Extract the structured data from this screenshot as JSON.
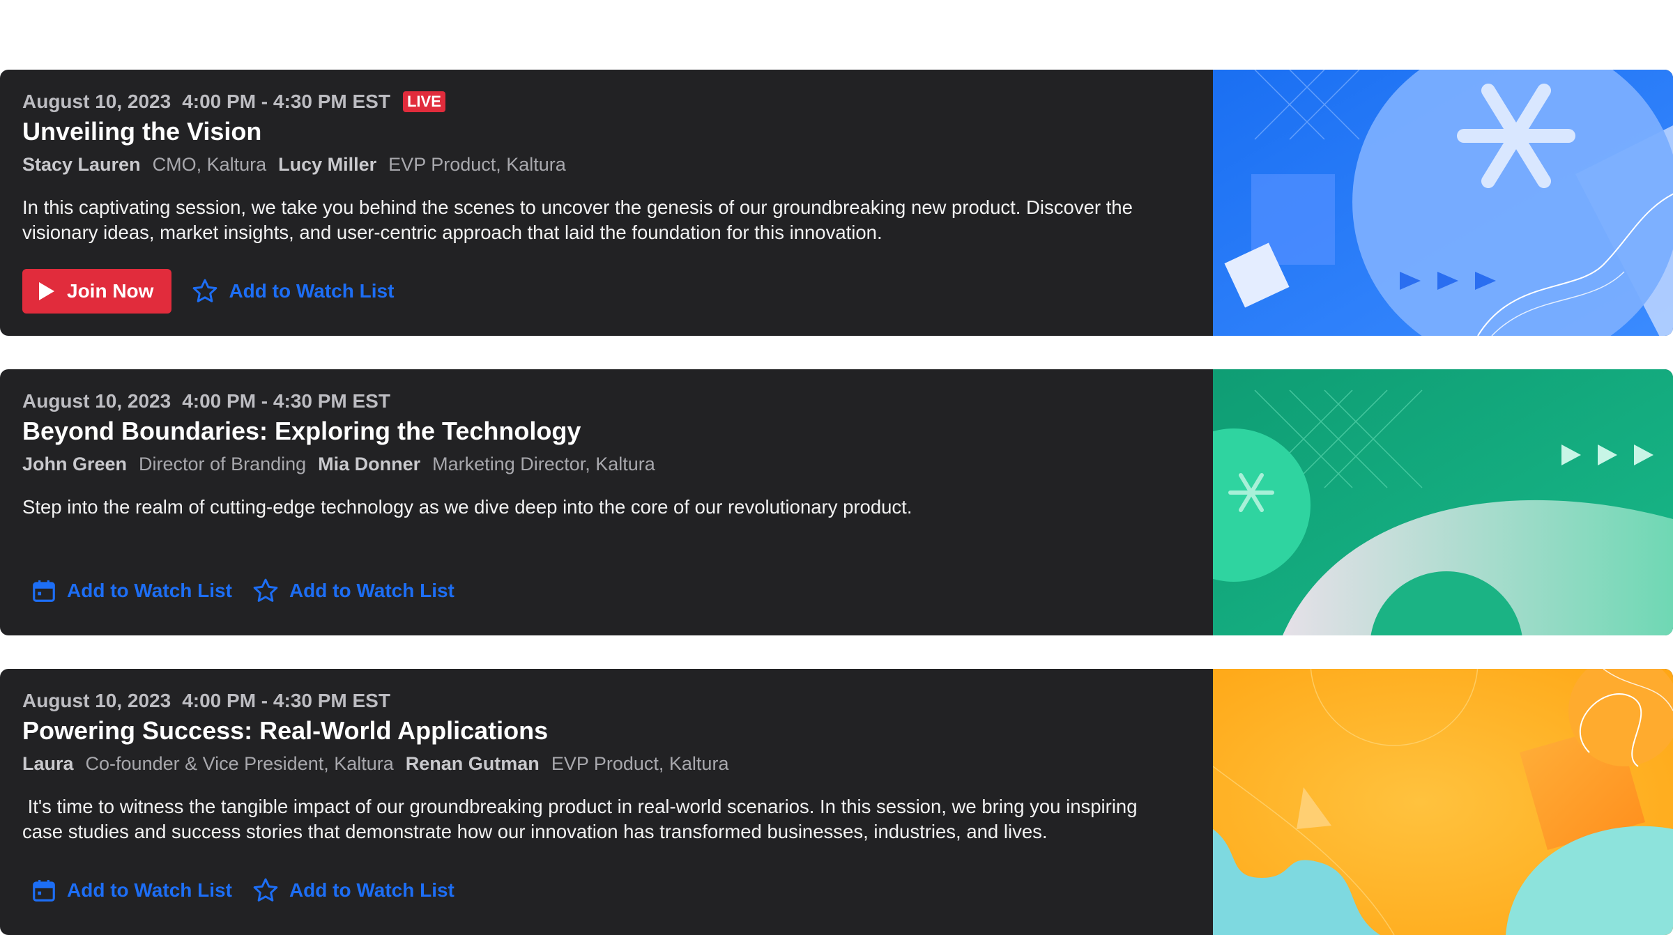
{
  "sessions": [
    {
      "date": "August 10, 2023",
      "time": "4:00 PM - 4:30 PM EST",
      "live_badge": "LIVE",
      "title": "Unveiling the Vision",
      "speakers": [
        {
          "name": "Stacy Lauren",
          "role": "CMO, Kaltura"
        },
        {
          "name": "Lucy Miller",
          "role": "EVP Product, Kaltura"
        }
      ],
      "description": "In this captivating session, we take you behind the scenes to uncover the genesis of our groundbreaking new product. Discover the visionary ideas, market insights, and user-centric approach that laid the foundation for this innovation.",
      "primary_action": {
        "label": "Join Now",
        "icon": "play-icon"
      },
      "secondary_action": {
        "label": "Add to Watch List",
        "icon": "star-icon"
      },
      "thumbnail_theme": "blue"
    },
    {
      "date": "August 10, 2023",
      "time": "4:00 PM - 4:30 PM EST",
      "title": "Beyond Boundaries: Exploring the Technology",
      "speakers": [
        {
          "name": "John Green",
          "role": "Director of Branding"
        },
        {
          "name": "Mia Donner",
          "role": "Marketing Director, Kaltura"
        }
      ],
      "description": "Step into the realm of cutting-edge technology as we dive deep into the core of our revolutionary product.",
      "calendar_action": {
        "label": "Add to Watch List",
        "icon": "calendar-icon"
      },
      "secondary_action": {
        "label": "Add to Watch List",
        "icon": "star-icon"
      },
      "thumbnail_theme": "green"
    },
    {
      "date": "August 10, 2023",
      "time": "4:00 PM - 4:30 PM EST",
      "title": "Powering Success: Real-World Applications",
      "speakers": [
        {
          "name": "Laura",
          "role": "Co-founder & Vice President, Kaltura"
        },
        {
          "name": "Renan Gutman",
          "role": "EVP Product, Kaltura"
        }
      ],
      "description": " It's time to witness the tangible impact of our groundbreaking product in real-world scenarios. In this session, we bring you inspiring case studies and success stories that demonstrate how our innovation has transformed businesses, industries, and lives.",
      "calendar_action": {
        "label": "Add to Watch List",
        "icon": "calendar-icon"
      },
      "secondary_action": {
        "label": "Add to Watch List",
        "icon": "star-icon"
      },
      "thumbnail_theme": "orange"
    }
  ],
  "colors": {
    "card_background": "#222224",
    "live_red": "#e12c3c",
    "link_blue": "#1d6ef5",
    "page_background": "#ffffff"
  }
}
